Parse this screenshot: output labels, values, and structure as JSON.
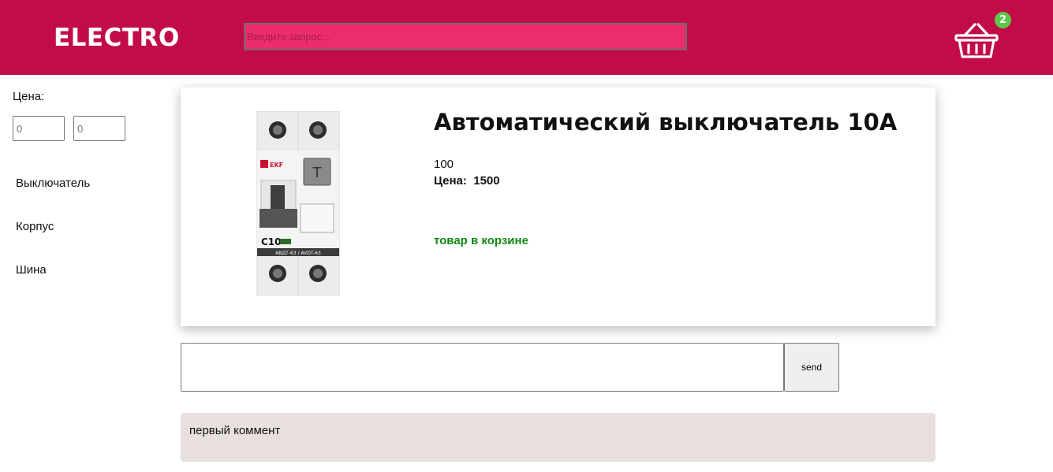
{
  "header": {
    "logo": "ELECTRO",
    "search_placeholder": "Введите запрос...",
    "cart_count": "2"
  },
  "filters": {
    "price_label": "Цена:",
    "min_price": "0",
    "max_price": "0"
  },
  "categories": [
    "Выключатель",
    "Корпус",
    "Шина"
  ],
  "product": {
    "title": "Автоматический выключатель 10А",
    "quantity": "100",
    "price_label": "Цена:",
    "price": "1500",
    "status": "товар в корзине",
    "image_text": {
      "brand": "EKF",
      "rating": "C10",
      "model": "АВДТ-63 / AVDT-63"
    }
  },
  "comment_form": {
    "send_label": "send"
  },
  "comments": [
    "первый коммент"
  ],
  "colors": {
    "header_bg": "#c20c47",
    "search_bg": "#ec2c6c",
    "badge": "#5cc84a",
    "status_green": "#108a10",
    "comment_bg": "#e8e0de"
  }
}
